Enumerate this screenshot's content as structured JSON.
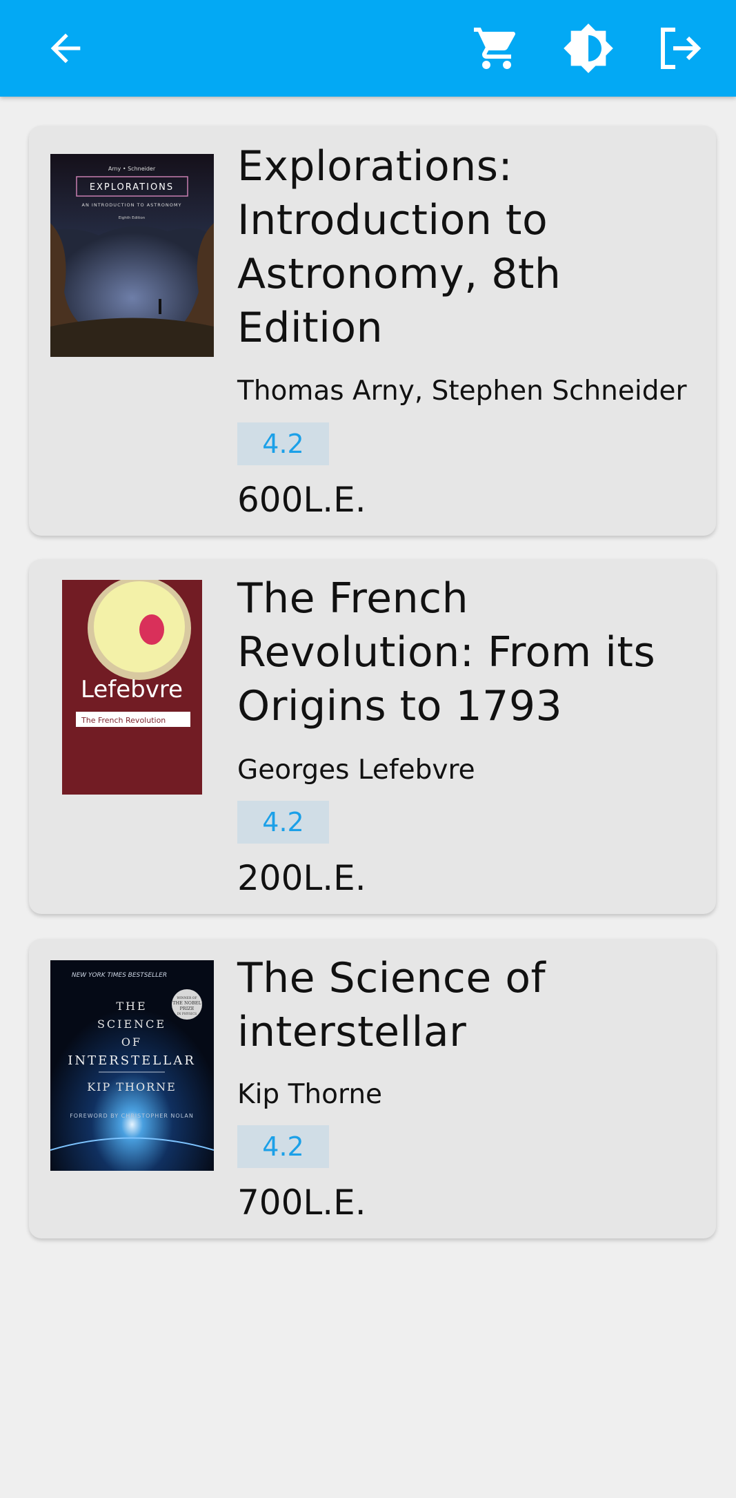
{
  "appbar": {
    "back_icon": "arrow-left-icon",
    "cart_icon": "shopping-cart-icon",
    "theme_icon": "brightness-icon",
    "logout_icon": "logout-icon",
    "color": "#03a9f4"
  },
  "books": [
    {
      "title": "Explorations: Introduction to Astronomy, 8th Edition",
      "author": "Thomas Arny, Stephen Schneider",
      "rating": "4.2",
      "price": "600L.E.",
      "cover": {
        "authors_line": "Arny • Schneider",
        "heading": "EXPLORATIONS",
        "subtitle": "AN INTRODUCTION TO ASTRONOMY",
        "edition": "Eighth Edition"
      }
    },
    {
      "title": "The French Revolution: From its Origins to 1793",
      "author": "Georges Lefebvre",
      "rating": "4.2",
      "price": "200L.E.",
      "cover": {
        "author_name": "Lefebvre",
        "label": "The French Revolution"
      }
    },
    {
      "title": "The Science of interstellar",
      "author": "Kip Thorne",
      "rating": "4.2",
      "price": "700L.E.",
      "cover": {
        "banner": "NEW YORK TIMES BESTSELLER",
        "line1": "THE",
        "line2": "SCIENCE",
        "line3": "OF",
        "line4": "INTERSTELLAR",
        "author": "KIP THORNE",
        "foreword": "FOREWORD BY CHRISTOPHER NOLAN",
        "badge1": "WINNER OF",
        "badge2": "THE NOBEL",
        "badge3": "PRIZE",
        "badge4": "IN PHYSICS"
      }
    }
  ]
}
